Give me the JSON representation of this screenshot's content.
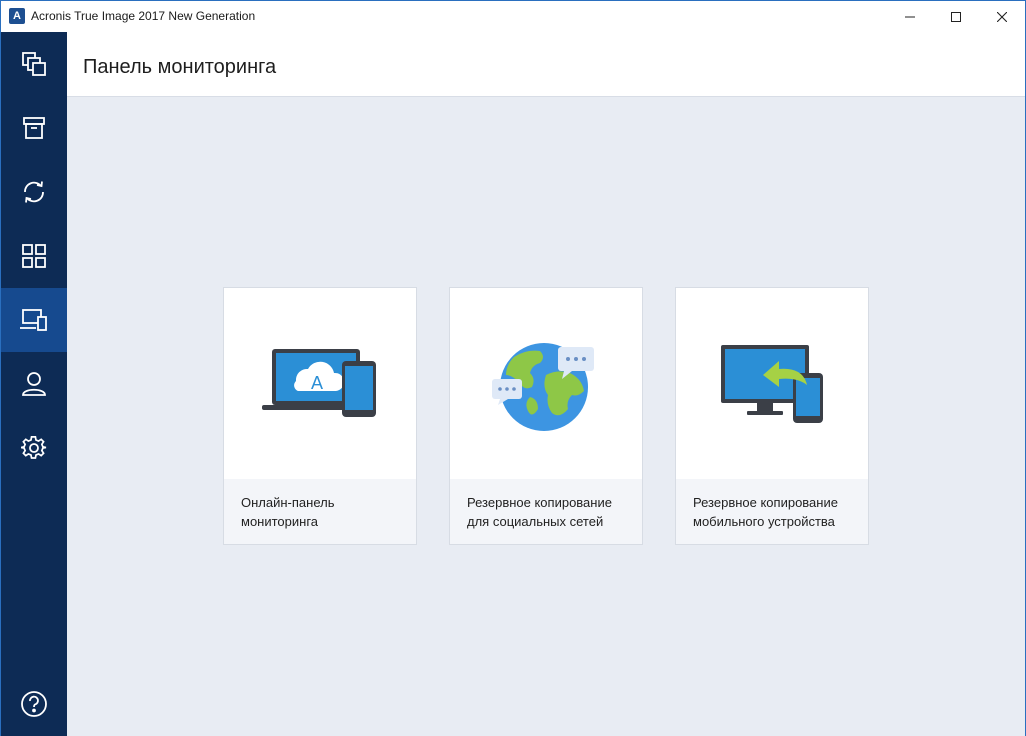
{
  "window": {
    "title": "Acronis True Image 2017 New Generation",
    "logo_letter": "A"
  },
  "sidebar": {
    "items": [
      {
        "icon": "backup-icon",
        "active": false
      },
      {
        "icon": "archive-icon",
        "active": false
      },
      {
        "icon": "sync-icon",
        "active": false
      },
      {
        "icon": "tools-icon",
        "active": false
      },
      {
        "icon": "dashboard-devices-icon",
        "active": true
      },
      {
        "icon": "account-icon",
        "active": false
      },
      {
        "icon": "settings-icon",
        "active": false
      }
    ],
    "help_icon": "help-icon"
  },
  "header": {
    "title": "Панель мониторинга"
  },
  "cards": [
    {
      "line1": "Онлайн-панель",
      "line2": "мониторинга",
      "icon": "laptop-cloud-phone-illustration"
    },
    {
      "line1": "Резервное копирование",
      "line2": "для социальных сетей",
      "icon": "globe-chat-illustration"
    },
    {
      "line1": "Резервное копирование",
      "line2": "мобильного устройства",
      "icon": "monitor-phone-illustration"
    }
  ],
  "colors": {
    "sidebar": "#0d2b55",
    "sidebar_active": "#164a8f",
    "content_bg": "#e8ecf3",
    "accent": "#2a6fbf"
  }
}
